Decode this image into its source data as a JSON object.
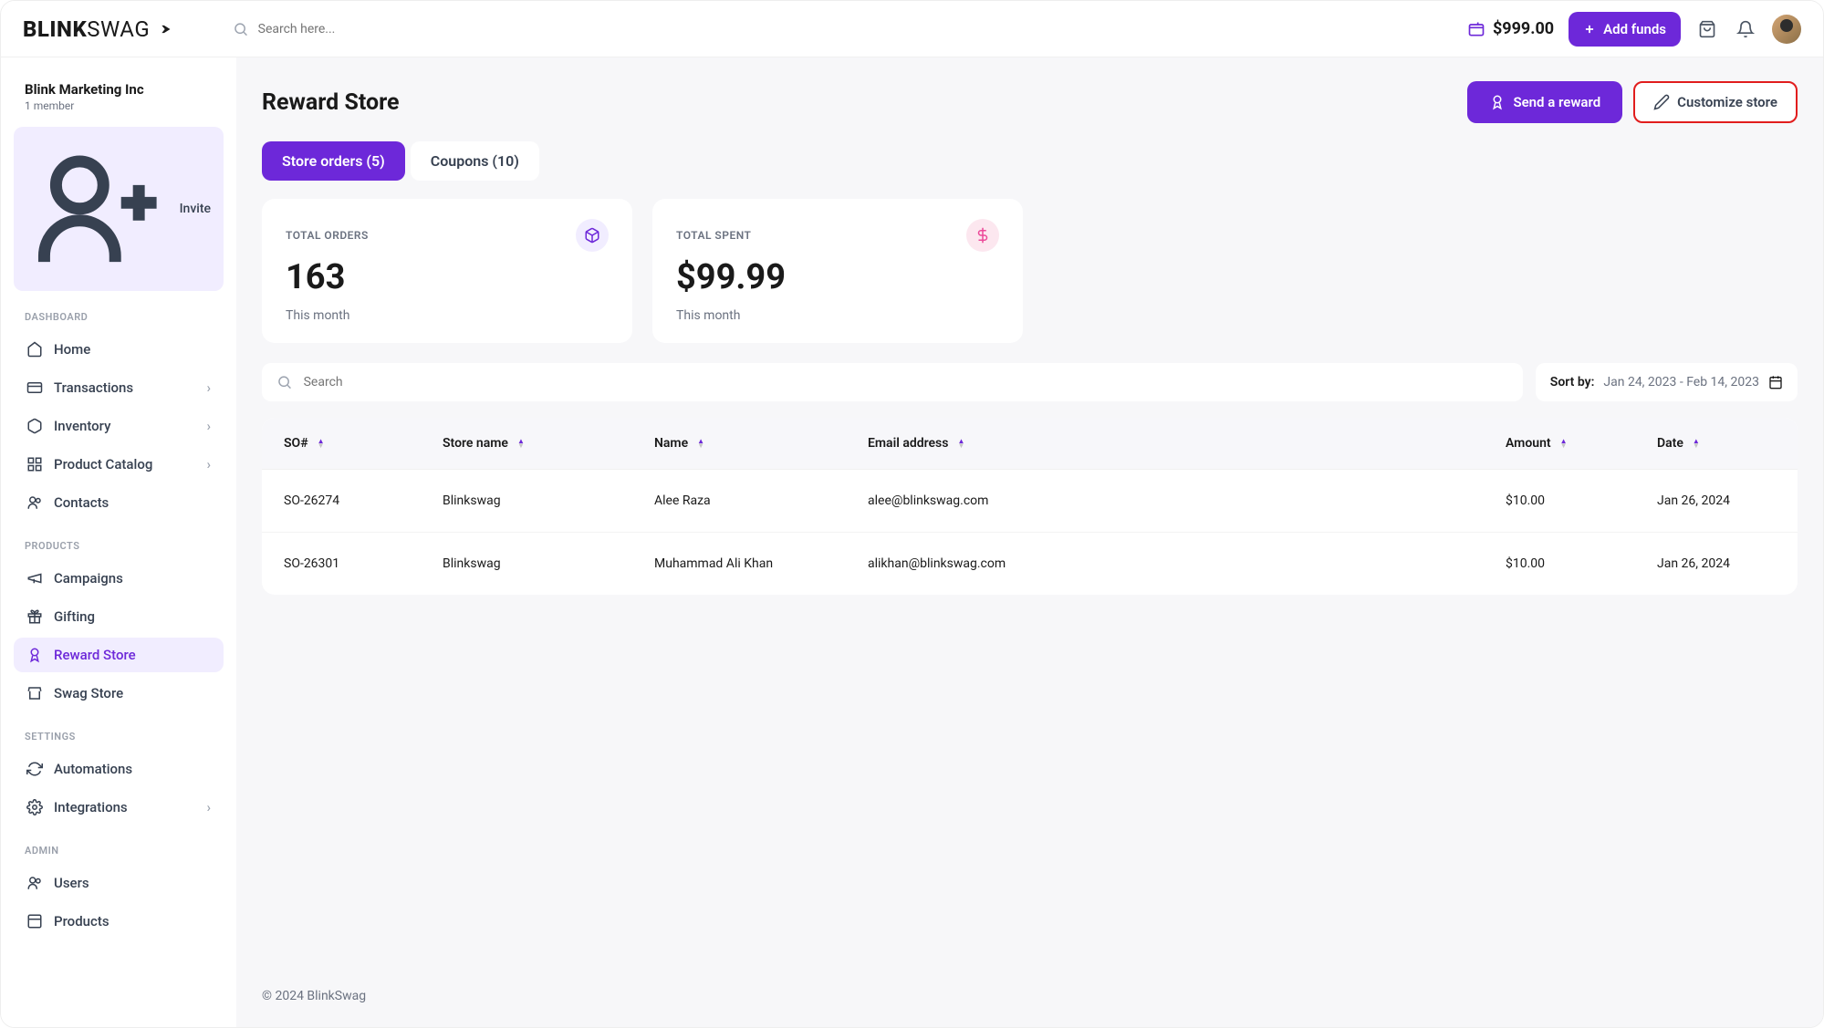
{
  "header": {
    "logo": {
      "a": "BLINK",
      "b": "SWAG"
    },
    "search_placeholder": "Search here...",
    "balance": "$999.00",
    "add_funds": "Add funds"
  },
  "org": {
    "name": "Blink Marketing Inc",
    "sub": "1 member"
  },
  "invite_label": "Invite",
  "sections": {
    "dashboard": "DASHBOARD",
    "products": "PRODUCTS",
    "settings": "SETTINGS",
    "admin": "ADMIN"
  },
  "nav": {
    "home": "Home",
    "transactions": "Transactions",
    "inventory": "Inventory",
    "product_catalog": "Product Catalog",
    "contacts": "Contacts",
    "campaigns": "Campaigns",
    "gifting": "Gifting",
    "reward_store": "Reward Store",
    "swag_store": "Swag Store",
    "automations": "Automations",
    "integrations": "Integrations",
    "users": "Users",
    "products_admin": "Products"
  },
  "page": {
    "title": "Reward Store",
    "send_reward": "Send a reward",
    "customize": "Customize store"
  },
  "tabs": {
    "orders": "Store orders (5)",
    "coupons": "Coupons (10)"
  },
  "cards": {
    "orders": {
      "label": "TOTAL ORDERS",
      "value": "163",
      "sub": "This month"
    },
    "spent": {
      "label": "TOTAL SPENT",
      "value": "$99.99",
      "sub": "This month"
    }
  },
  "search_orders_placeholder": "Search",
  "sort": {
    "label": "Sort by:",
    "value": "Jan 24, 2023 - Feb 14, 2023"
  },
  "columns": {
    "so": "SO#",
    "store": "Store name",
    "name": "Name",
    "email": "Email address",
    "amount": "Amount",
    "date": "Date"
  },
  "rows": [
    {
      "so": "SO-26274",
      "store": "Blinkswag",
      "name": "Alee Raza",
      "email": "alee@blinkswag.com",
      "amount": "$10.00",
      "date": "Jan 26, 2024"
    },
    {
      "so": "SO-26301",
      "store": "Blinkswag",
      "name": "Muhammad Ali Khan",
      "email": "alikhan@blinkswag.com",
      "amount": "$10.00",
      "date": "Jan 26, 2024"
    }
  ],
  "footer": "© 2024 BlinkSwag"
}
